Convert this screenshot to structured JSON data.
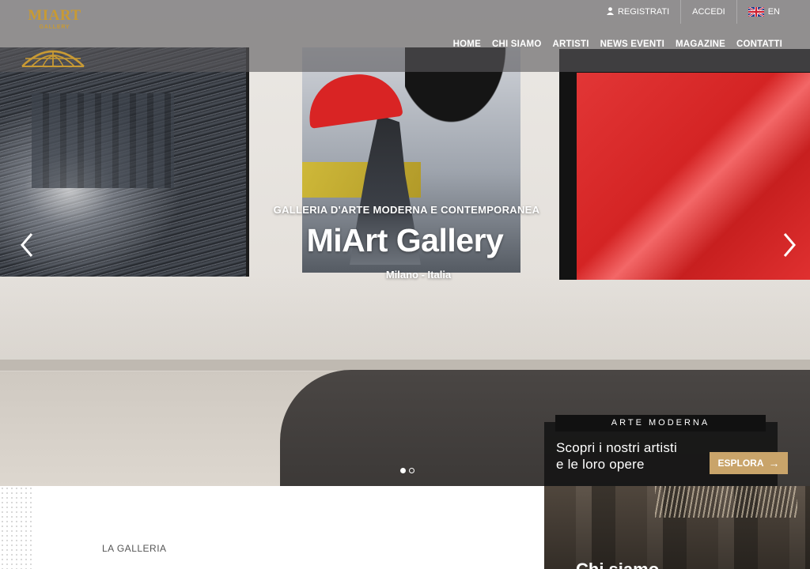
{
  "header": {
    "logo": {
      "name": "MIART",
      "sub": "GALLERY"
    },
    "topbar": {
      "register": "REGISTRATI",
      "login": "ACCEDI",
      "language": "EN"
    },
    "nav": [
      "HOME",
      "CHI SIAMO",
      "ARTISTI",
      "NEWS EVENTI",
      "MAGAZINE",
      "CONTATTI"
    ]
  },
  "hero": {
    "kicker": "GALLERIA D'ARTE MODERNA E CONTEMPORANEA",
    "title": "MiArt Gallery",
    "subtitle": "Milano - Italia",
    "slides": 2,
    "active_slide": 1
  },
  "promo": {
    "label": "ARTE MODERNA",
    "line1": "Scopri i nostri artisti",
    "line2": "e le loro opere",
    "button": "ESPLORA"
  },
  "section": {
    "label": "LA GALLERIA"
  },
  "side": {
    "title": "Chi siamo"
  },
  "colors": {
    "accent": "#c9a46a",
    "logo_gold": "#c89a34"
  }
}
